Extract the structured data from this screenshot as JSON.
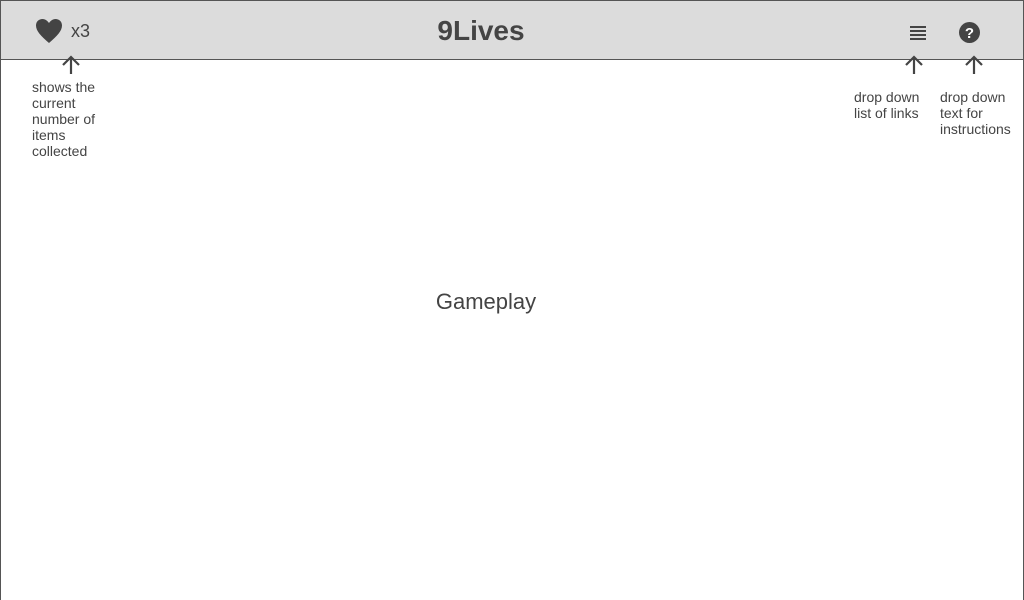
{
  "header": {
    "lives_icon": "heart-icon",
    "lives_count": "x3",
    "title": "9Lives",
    "menu_icon": "menu-list-icon",
    "help_icon": "help-question-icon"
  },
  "annotations": {
    "items_note": "shows the\ncurrent\nnumber of\nitems\ncollected",
    "links_note": "drop down\nlist of links",
    "instructions_note": "drop down\ntext for\ninstructions"
  },
  "main": {
    "placeholder": "Gameplay"
  },
  "colors": {
    "header_bg": "#dcdcdc",
    "border": "#555555",
    "text": "#444444"
  }
}
